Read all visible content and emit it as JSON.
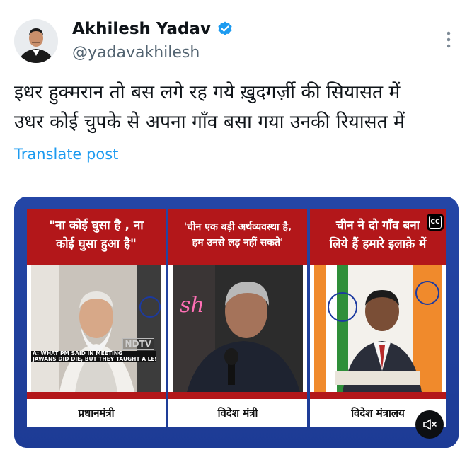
{
  "author": {
    "name": "Akhilesh Yadav",
    "handle": "@yadavakhilesh",
    "verified": true,
    "accent_color": "#1d9bf0"
  },
  "post": {
    "line1": "इधर हुक्मरान तो बस लगे रह गये ख़ुदगर्ज़ी की सियासत में",
    "line2": "उधर कोई चुपके से अपना गाँव बसा गया उनकी रियासत में",
    "translate_label": "Translate post"
  },
  "media": {
    "panels": [
      {
        "quote_line1": "\"ना कोई घुसा है , ना",
        "quote_line2": "कोई घुसा हुआ है\"",
        "caption": "प्रधानमंत्री",
        "channel_logo": "NDTV",
        "ticker_line1": "A: WHAT PM SAID IN MEETING",
        "ticker_line2": "JAWANS DID DIE, BUT THEY TAUGHT A LESSON'"
      },
      {
        "quote_line1": "'चीन एक बड़ी अर्थव्यवस्था है,",
        "quote_line2": "हम उनसे लड़ नहीं सकते'",
        "caption": "विदेश मंत्री",
        "neon_text": "sh"
      },
      {
        "quote_line1": "चीन ने दो गाँव बना",
        "quote_line2": "लिये हैं हमारे इलाक़े में",
        "caption": "विदेश मंत्रालय"
      }
    ],
    "cc_label": "CC",
    "mute_icon": "speaker-muted-icon",
    "more_icon": "vertical-dots-icon",
    "panel_red": "#b3171a",
    "frame_blue": "#1f3f9c"
  }
}
